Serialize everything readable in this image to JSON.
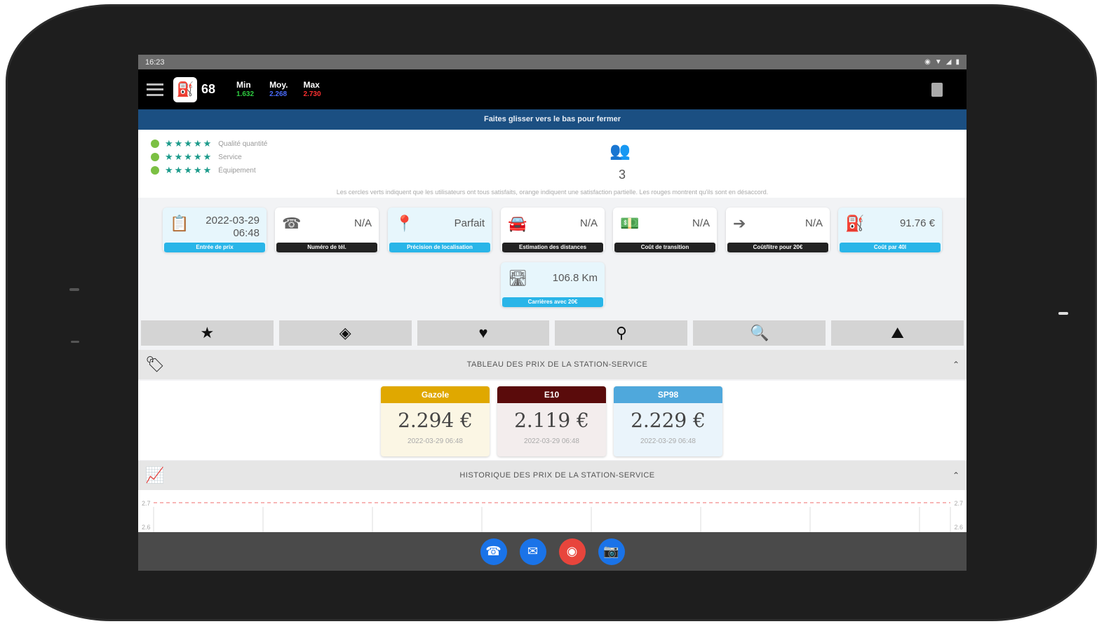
{
  "status": {
    "time": "16:23",
    "icons": [
      "◉",
      "▼",
      "◢",
      "▮"
    ]
  },
  "appbar": {
    "dept": "68",
    "stats": [
      {
        "label": "Min",
        "value": "1.632",
        "color": "#2ecc40"
      },
      {
        "label": "Moy.",
        "value": "2.268",
        "color": "#4a6cff"
      },
      {
        "label": "Max",
        "value": "2.730",
        "color": "#ff3030"
      }
    ]
  },
  "swipe_text": "Faites glisser vers le bas pour fermer",
  "ratings": {
    "items": [
      {
        "stars": "★★★★★",
        "label": "Qualité quantité"
      },
      {
        "stars": "★★★★★",
        "label": "Service"
      },
      {
        "stars": "★★★★★",
        "label": "Équipement"
      }
    ],
    "users_count": "3",
    "note": "Les cercles verts indiquent que les utilisateurs ont tous satisfaits, orange indiquent une satisfaction partielle. Les rouges montrent qu'ils sont en désaccord."
  },
  "cards": [
    {
      "icon": "📋",
      "value": "2022-03-29",
      "value2": "06:48",
      "footer": "Entrée de prix",
      "style": "blue"
    },
    {
      "icon": "☎",
      "value": "N/A",
      "value2": "",
      "footer": "Numéro de tél.",
      "style": "dark"
    },
    {
      "icon": "📍",
      "value": "Parfait",
      "value2": "",
      "footer": "Précision de localisation",
      "style": "blue"
    },
    {
      "icon": "🚘",
      "value": "N/A",
      "value2": "",
      "footer": "Estimation des distances",
      "style": "dark"
    },
    {
      "icon": "💵",
      "value": "N/A",
      "value2": "",
      "footer": "Coût de transition",
      "style": "dark"
    },
    {
      "icon": "➔",
      "value": "N/A",
      "value2": "",
      "footer": "Coût/litre pour 20€",
      "style": "dark"
    },
    {
      "icon": "⛽",
      "value": "91.76 €",
      "value2": "",
      "footer": "Coût par 40l",
      "style": "blue"
    },
    {
      "icon": "🛣",
      "value": "106.8 Km",
      "value2": "",
      "footer": "Carrières avec 20€",
      "style": "blue"
    }
  ],
  "tools": [
    "★",
    "◈",
    "♥",
    "⚲",
    "🔍",
    "⛰"
  ],
  "prices_section": {
    "title": "TABLEAU DES PRIX DE LA STATION-SERVICE",
    "icon": "🏷",
    "chevron": "⌃"
  },
  "prices": [
    {
      "fuel": "Gazole",
      "price": "2.294 €",
      "date": "2022-03-29 06:48",
      "head_color": "#e0a800",
      "bg": "#fbf6e4"
    },
    {
      "fuel": "E10",
      "price": "2.119 €",
      "date": "2022-03-29 06:48",
      "head_color": "#5a0b0b",
      "bg": "#f3eded"
    },
    {
      "fuel": "SP98",
      "price": "2.229 €",
      "date": "2022-03-29 06:48",
      "head_color": "#4fa8dc",
      "bg": "#eaf4fb"
    }
  ],
  "history_section": {
    "title": "HISTORIQUE DES PRIX DE LA STATION-SERVICE",
    "icon": "📈",
    "chevron": "⌃"
  },
  "history_ticks": {
    "left_top": "2.7",
    "left_bottom": "2.6",
    "right_top": "2.7",
    "right_bottom": "2.6"
  },
  "nav_icons": [
    {
      "glyph": "☎",
      "color": "#1a73e8"
    },
    {
      "glyph": "✉",
      "color": "#1a73e8"
    },
    {
      "glyph": "◉",
      "color": "#e8453c"
    },
    {
      "glyph": "📷",
      "color": "#1a73e8"
    }
  ]
}
